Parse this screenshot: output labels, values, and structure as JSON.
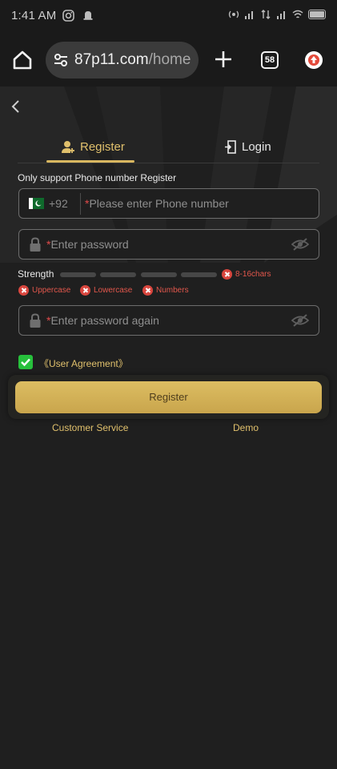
{
  "status_bar": {
    "time": "1:41 AM",
    "battery_label": "99"
  },
  "browser": {
    "url_host": "87p11.com",
    "url_path": "/home",
    "tab_count": "58"
  },
  "tabs": {
    "register": "Register",
    "login": "Login"
  },
  "form": {
    "hint": "Only support Phone number Register",
    "country_code": "+92",
    "required_mark": "*",
    "phone_placeholder": "Please enter Phone number",
    "password_placeholder": "Enter password",
    "password_again_placeholder": "Enter password again"
  },
  "strength": {
    "label": "Strength",
    "level": 0,
    "segments": 4,
    "rules": {
      "length": "8-16chars",
      "uppercase": "Uppercase",
      "lowercase": "Lowercase",
      "numbers": "Numbers"
    }
  },
  "agreement": {
    "checked": true,
    "text": "《User Agreement》"
  },
  "actions": {
    "register_button": "Register",
    "customer_service": "Customer Service",
    "demo": "Demo"
  },
  "colors": {
    "accent_gold": "#e0c06c",
    "button_gold": "#d4b45a",
    "error_red": "#e2574c",
    "check_green": "#27c03c",
    "background": "#1f1f1f"
  },
  "icons": {
    "home": "home-icon",
    "url_settings": "tune-icon",
    "new_tab": "plus-icon",
    "update": "update-icon",
    "back": "chevron-left-icon",
    "register_tab": "user-add-icon",
    "login_tab": "door-enter-icon",
    "lock": "lock-icon",
    "eye_off": "eye-off-icon",
    "flag": "pakistan-flag-icon"
  }
}
